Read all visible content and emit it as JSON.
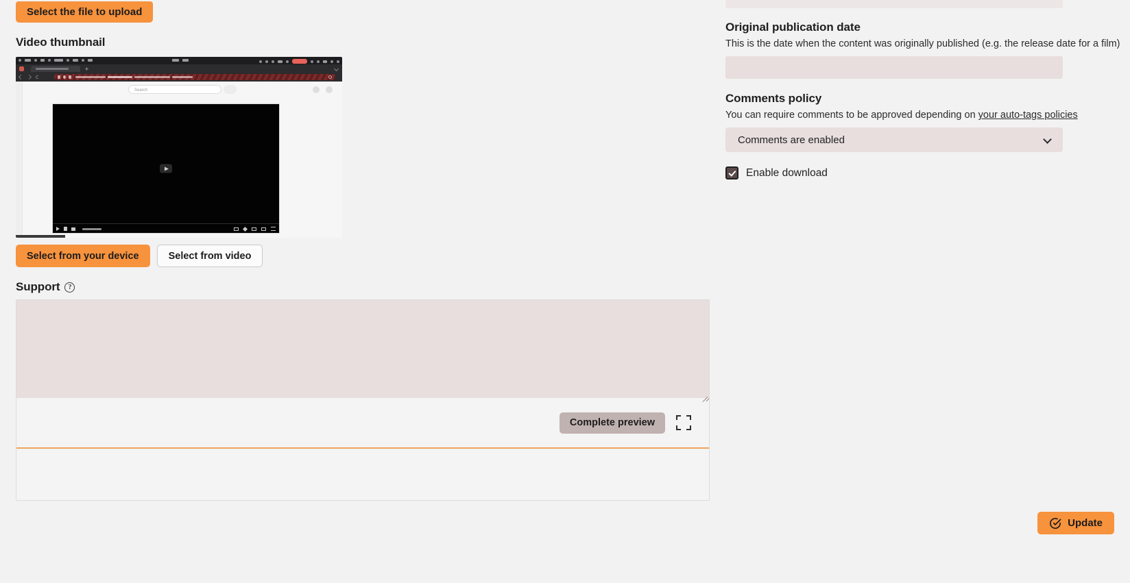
{
  "upload": {
    "select_file_label": "Select the file to upload"
  },
  "thumbnail": {
    "heading": "Video thumbnail",
    "preview": {
      "browser_search_placeholder": "Search"
    },
    "select_device_label": "Select from your device",
    "select_video_label": "Select from video"
  },
  "support": {
    "heading": "Support",
    "help_icon": "question-circle-icon",
    "editor_value": "",
    "editor_placeholder": "",
    "complete_preview_label": "Complete preview",
    "expand_icon": "fullscreen-expand-icon"
  },
  "sidebar_right": {
    "publication_date": {
      "label": "Original publication date",
      "description": "This is the date when the content was originally published (e.g. the release date for a film)",
      "value": "",
      "placeholder": ""
    },
    "comments_policy": {
      "label": "Comments policy",
      "description_prefix": "You can require comments to be approved depending on ",
      "description_link": "your auto-tags policies",
      "selected_option": "Comments are enabled",
      "chevron_icon": "chevron-down-icon"
    },
    "enable_download": {
      "label": "Enable download",
      "checked": true
    }
  },
  "footer": {
    "update_label": "Update",
    "update_icon": "check-circle-icon"
  },
  "colors": {
    "accent_orange": "#f7923d",
    "divider_orange": "#f0a45e",
    "field_pink": "#e7dedd",
    "preview_button": "#c0b2b1",
    "page_background": "#f2f2f2"
  }
}
